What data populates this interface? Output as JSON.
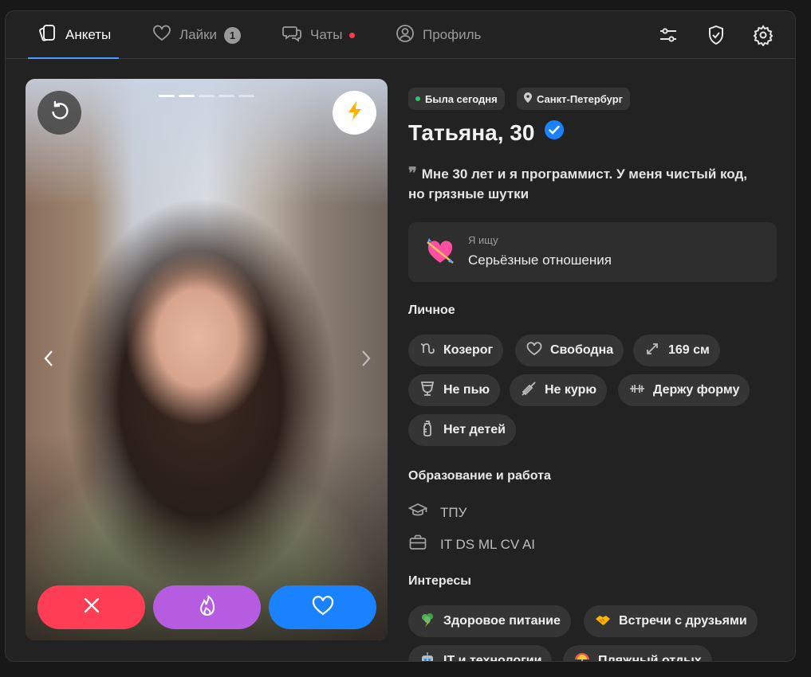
{
  "nav": {
    "tabs": [
      {
        "label": "Анкеты",
        "icon": "cards-icon",
        "active": true
      },
      {
        "label": "Лайки",
        "icon": "heart-icon",
        "badge": "1"
      },
      {
        "label": "Чаты",
        "icon": "chat-icon",
        "unread_dot": true
      },
      {
        "label": "Профиль",
        "icon": "profile-icon"
      }
    ],
    "right_icons": [
      "filters-icon",
      "shield-icon",
      "settings-icon"
    ]
  },
  "photo": {
    "page_count": 5,
    "current_page": 2,
    "buttons": {
      "undo": "undo-icon",
      "boost": "lightning-icon",
      "prev": "chevron-left-icon",
      "next": "chevron-right-icon",
      "dislike": "close-icon",
      "superlike": "flame-icon",
      "like": "heart-icon"
    }
  },
  "profile": {
    "status": "Была сегодня",
    "city": "Санкт-Петербург",
    "name_age": "Татьяна, 30",
    "verified": true,
    "bio": "Мне 30 лет и я программист. У меня чистый код, но грязные шутки",
    "seeking": {
      "label": "Я ищу",
      "value": "Серьёзные отношения"
    },
    "personal": {
      "title": "Личное",
      "tags": [
        {
          "label": "Козерог",
          "icon": "capricorn-icon"
        },
        {
          "label": "Свободна",
          "icon": "heart-outline-icon"
        },
        {
          "label": "169 см",
          "icon": "expand-icon"
        },
        {
          "label": "Не пью",
          "icon": "glass-icon"
        },
        {
          "label": "Не курю",
          "icon": "no-smoking-icon"
        },
        {
          "label": "Держу форму",
          "icon": "dumbbell-icon"
        },
        {
          "label": "Нет детей",
          "icon": "baby-bottle-icon"
        }
      ]
    },
    "education": {
      "title": "Образование и работа",
      "school": "ТПУ",
      "work": "IT DS ML CV AI"
    },
    "interests": {
      "title": "Интересы",
      "tags": [
        {
          "label": "Здоровое питание",
          "icon": "broccoli-icon"
        },
        {
          "label": "Встречи с друзьями",
          "icon": "handshake-icon"
        },
        {
          "label": "IT и технологии",
          "icon": "robot-icon"
        },
        {
          "label": "Пляжный отдых",
          "icon": "umbrella-icon"
        }
      ]
    }
  },
  "colors": {
    "accent": "#1a82ff",
    "dislike": "#ff3d55",
    "superlike": "#b65ce0",
    "online": "#3ac45e"
  }
}
